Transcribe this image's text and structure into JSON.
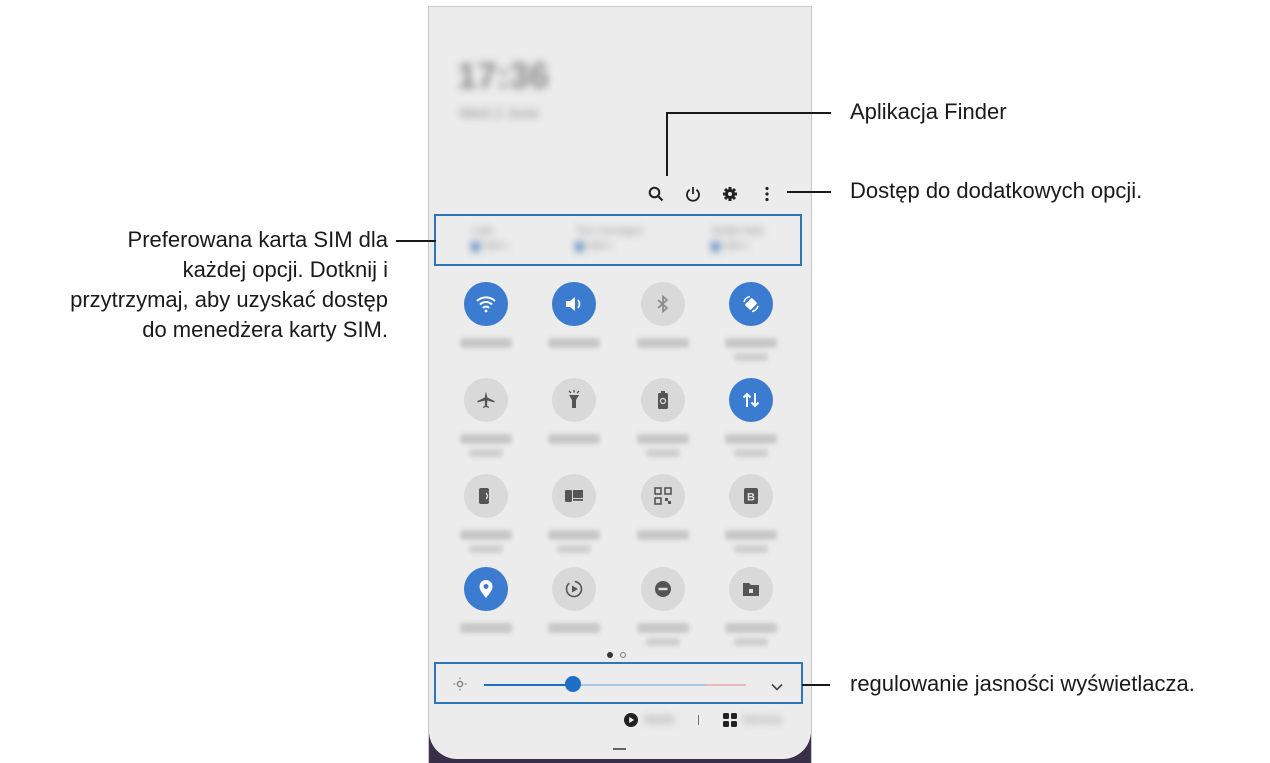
{
  "callouts": {
    "finder": "Aplikacja Finder",
    "more_options": "Dostęp do dodatkowych opcji.",
    "sim_line1": "Preferowana karta SIM dla",
    "sim_line2": "każdej opcji. Dotknij i",
    "sim_line3": "przytrzymaj, aby uzyskać dostęp",
    "sim_line4": "do menedżera karty SIM.",
    "brightness": "regulowanie jasności wyświetlacza."
  },
  "status": {
    "clock": "17:36",
    "date": "Wed 2 June"
  },
  "top_icons": [
    "search-icon",
    "power-icon",
    "gear-icon",
    "more-vertical-icon"
  ],
  "sim": [
    {
      "label": "Calls",
      "value": "SIM 1",
      "badge": "1"
    },
    {
      "label": "Text messages",
      "value": "SIM 1",
      "badge": "1"
    },
    {
      "label": "Mobile data",
      "value": "SIM 1",
      "badge": "1"
    }
  ],
  "tiles": [
    {
      "icon": "wifi-icon",
      "state": "on"
    },
    {
      "icon": "sound-icon",
      "state": "on"
    },
    {
      "icon": "bluetooth-icon",
      "state": "off"
    },
    {
      "icon": "auto-rotate-icon",
      "state": "on"
    },
    {
      "icon": "airplane-icon",
      "state": "off"
    },
    {
      "icon": "flashlight-icon",
      "state": "off"
    },
    {
      "icon": "power-saving-icon",
      "state": "off"
    },
    {
      "icon": "mobile-data-icon",
      "state": "on"
    },
    {
      "icon": "nfc-icon",
      "state": "off"
    },
    {
      "icon": "link-to-windows-icon",
      "state": "off"
    },
    {
      "icon": "qr-scanner-icon",
      "state": "off"
    },
    {
      "icon": "bixby-routines-icon",
      "state": "off"
    },
    {
      "icon": "location-icon",
      "state": "on"
    },
    {
      "icon": "screen-recorder-icon",
      "state": "off"
    },
    {
      "icon": "do-not-disturb-icon",
      "state": "off"
    },
    {
      "icon": "secure-folder-icon",
      "state": "off"
    }
  ],
  "brightness": {
    "level": 0.33
  },
  "bottom": {
    "media_label": "Media",
    "devices_label": "Devices"
  },
  "colors": {
    "accent": "#3b7bd0",
    "box": "#2c77b7",
    "panel": "#ececec"
  }
}
